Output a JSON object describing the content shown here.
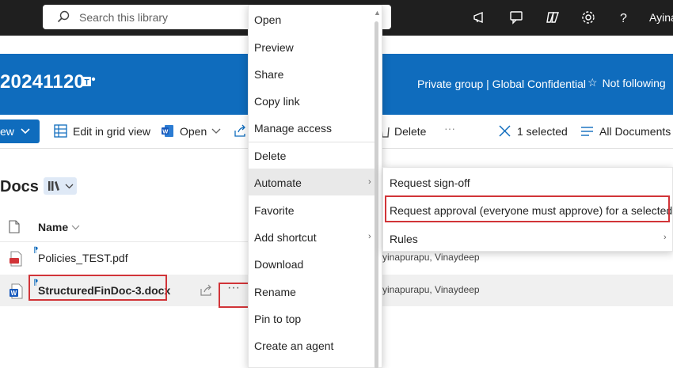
{
  "topbar": {
    "search_placeholder": "Search this library",
    "user": "Ayina"
  },
  "site": {
    "title": "20241120",
    "meta": "Private group | Global Confidential",
    "follow": "Not following"
  },
  "commands": {
    "new": "ew",
    "edit_grid": "Edit in grid view",
    "open": "Open",
    "delete": "Delete",
    "more": "···",
    "selected": "1 selected",
    "view": "All Documents"
  },
  "library": {
    "title": "Docs",
    "column_name": "Name"
  },
  "files": [
    {
      "name": "Policies_TEST.pdf",
      "modified_by": "yinapurapu, Vinaydeep"
    },
    {
      "name": "StructuredFinDoc-3.docx",
      "modified_by": "yinapurapu, Vinaydeep"
    }
  ],
  "row_more": "···",
  "context_menu": [
    {
      "label": "Open"
    },
    {
      "label": "Preview"
    },
    {
      "label": "Share"
    },
    {
      "label": "Copy link"
    },
    {
      "label": "Manage access"
    },
    {
      "label": "Delete"
    },
    {
      "label": "Automate"
    },
    {
      "label": "Favorite"
    },
    {
      "label": "Add shortcut"
    },
    {
      "label": "Download"
    },
    {
      "label": "Rename"
    },
    {
      "label": "Pin to top"
    },
    {
      "label": "Create an agent"
    }
  ],
  "submenu": [
    {
      "label": "Request sign-off"
    },
    {
      "label": "Request approval (everyone must approve) for a selected file"
    },
    {
      "label": "Rules"
    }
  ],
  "colors": {
    "brand": "#0f6cbd",
    "suite_bar": "#1f1f1f",
    "highlight": "#d13438"
  }
}
